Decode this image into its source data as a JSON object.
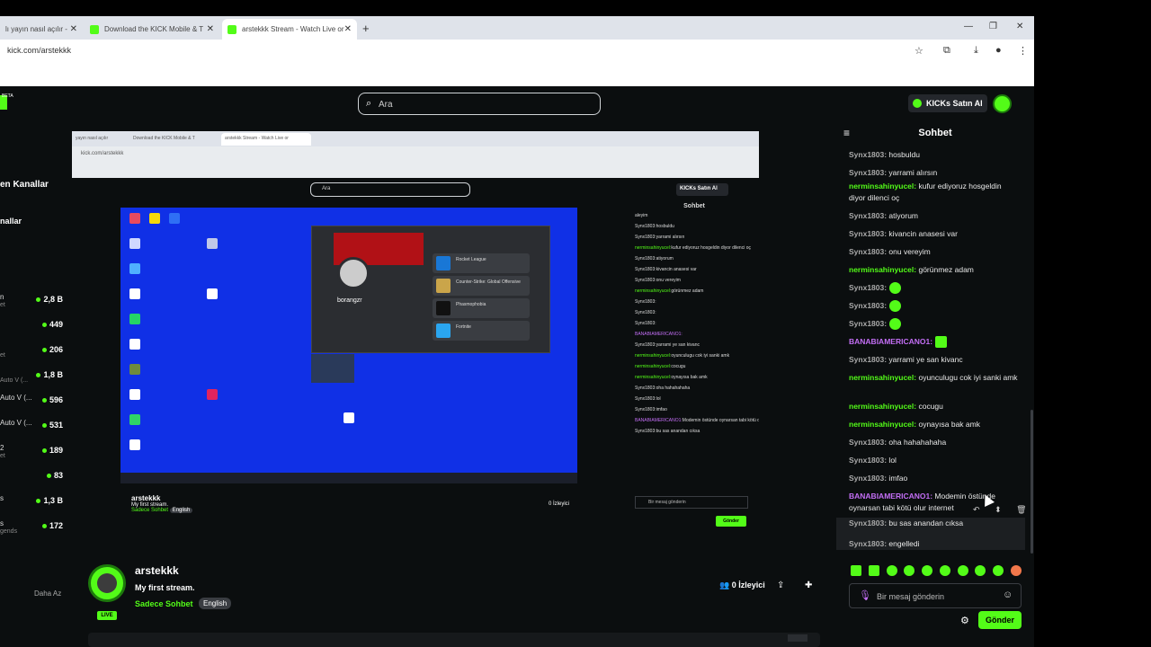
{
  "browser": {
    "tabs": [
      {
        "label": "lı yayın nasıl açılır - "
      },
      {
        "label": "Download the KICK Mobile & T"
      },
      {
        "label": "arstekkk Stream - Watch Live or"
      }
    ],
    "address": "kick.com/arstekkk"
  },
  "topnav": {
    "search_placeholder": "Ara",
    "kicks_label": "KICKs Satın Al",
    "beta": "BETA"
  },
  "sidebar": {
    "title1": "en Kanallar",
    "title2": "nallar",
    "items": [
      {
        "name": "n",
        "sub": "et",
        "count": "2,8 B"
      },
      {
        "name": "",
        "sub": "",
        "count": "449"
      },
      {
        "name": "",
        "sub": "et",
        "count": "206"
      },
      {
        "name": "",
        "sub": "Auto V (...",
        "count": "1,8 B"
      },
      {
        "name": "Auto V (...",
        "sub": "",
        "count": "596"
      },
      {
        "name": "Auto V (...",
        "sub": "",
        "count": "531"
      },
      {
        "name": "2",
        "sub": "et",
        "count": "189"
      },
      {
        "name": "",
        "sub": "",
        "count": "83"
      },
      {
        "name": "s",
        "sub": "",
        "count": "1,3 B"
      },
      {
        "name": "s",
        "sub": "gends",
        "count": "172"
      }
    ],
    "more": "Daha Az"
  },
  "inner": {
    "tabs": [
      "yayın nasıl açılır",
      "Download the KICK Mobile & T",
      "arstekkk Stream - Watch Live or"
    ],
    "address": "kick.com/arstekkk",
    "search": "Ara",
    "kicks": "KICKs Satın Al",
    "dialog_name": "borangzr",
    "games": [
      "Rocket League",
      "Counter-Strike: Global Offensive",
      "Phasmophobia",
      "Fortnite"
    ],
    "chat_title": "Sohbet",
    "chat_lines": [
      [
        "",
        "aleyim"
      ],
      [
        "Synx1803:",
        "hosbuldu"
      ],
      [
        "Synx1803:",
        "yarrami alırsın"
      ],
      [
        "nerminsahinyucel:",
        "kufur ediyoruz hosgeldin diyor dilenci oç"
      ],
      [
        "Synx1803:",
        "atiyorum"
      ],
      [
        "Synx1803:",
        "kivancin anasesi var"
      ],
      [
        "Synx1803:",
        "onu vereyim"
      ],
      [
        "nerminsahinyucel:",
        "görünmez adam"
      ],
      [
        "Synx1803:",
        ""
      ],
      [
        "Synx1803:",
        ""
      ],
      [
        "Synx1803:",
        ""
      ],
      [
        "BANABIAMERICANO1:",
        ""
      ],
      [
        "Synx1803:",
        "yarrami ye san kivanc"
      ],
      [
        "nerminsahinyucel:",
        "oyunculugu cok iyi sanki amk"
      ],
      [
        "nerminsahinyucel:",
        "cocugu"
      ],
      [
        "nerminsahinyucel:",
        "oynayısa bak amk"
      ],
      [
        "Synx1803:",
        "oha hahahahaha"
      ],
      [
        "Synx1803:",
        "lol"
      ],
      [
        "Synx1803:",
        "imfao"
      ],
      [
        "BANABIAMERICANO1:",
        "Modemin östünde oynarsan tabi kötü olur internet"
      ],
      [
        "Synx1803:",
        "bu sas anandan cıksa"
      ]
    ],
    "chat_placeholder": "Bir mesaj gönderin",
    "send": "Gönder",
    "streamer": "arstekkk",
    "title": "My first stream.",
    "category": "Sadece Sohbet",
    "lang": "English",
    "viewers": "0 İzleyici"
  },
  "stream": {
    "name": "arstekkk",
    "title": "My first stream.",
    "category": "Sadece Sohbet",
    "language": "English",
    "viewers": "0 İzleyici",
    "live": "LIVE"
  },
  "chat": {
    "title": "Sohbet",
    "messages": [
      {
        "user": "Synx1803:",
        "text": " hosbuldu",
        "color": "gray"
      },
      {
        "user": "Synx1803:",
        "text": " yarrami alırsın",
        "color": "gray"
      },
      {
        "user": "nerminsahinyucel:",
        "text": " kufur ediyoruz hosgeldin diyor dilenci oç",
        "color": "green"
      },
      {
        "user": "Synx1803:",
        "text": " atiyorum",
        "color": "gray"
      },
      {
        "user": "Synx1803:",
        "text": " kivancin anasesi var",
        "color": "gray"
      },
      {
        "user": "Synx1803:",
        "text": " onu vereyim",
        "color": "gray"
      },
      {
        "user": "nerminsahinyucel:",
        "text": " görünmez adam",
        "color": "green"
      },
      {
        "user": "Synx1803:",
        "text": "",
        "color": "gray",
        "emote": true
      },
      {
        "user": "Synx1803:",
        "text": "",
        "color": "gray",
        "emote": true
      },
      {
        "user": "Synx1803:",
        "text": "",
        "color": "gray",
        "emote": true
      },
      {
        "user": "BANABIAMERICANO1:",
        "text": "",
        "color": "purple",
        "emote": true
      },
      {
        "user": "Synx1803:",
        "text": " yarrami ye san kivanc",
        "color": "gray"
      },
      {
        "user": "nerminsahinyucel:",
        "text": " oyunculugu cok iyi sanki amk",
        "color": "green"
      },
      {
        "user": "nerminsahinyucel:",
        "text": " cocugu",
        "color": "green"
      },
      {
        "user": "nerminsahinyucel:",
        "text": " oynayısa bak amk",
        "color": "green"
      },
      {
        "user": "Synx1803:",
        "text": " oha hahahahaha",
        "color": "gray"
      },
      {
        "user": "Synx1803:",
        "text": " lol",
        "color": "gray"
      },
      {
        "user": "Synx1803:",
        "text": " imfao",
        "color": "gray"
      },
      {
        "user": "BANABIAMERICANO1:",
        "text": " Modemin östünde oynarsan tabi kötü olur internet",
        "color": "purple"
      },
      {
        "user": "Synx1803:",
        "text": " bu sas anandan cıksa",
        "color": "gray"
      },
      {
        "user": "Synx1803:",
        "text": " engelledi",
        "color": "gray"
      }
    ],
    "input_placeholder": "Bir mesaj gönderin",
    "send_label": "Gönder"
  },
  "colors": {
    "accent": "#53fc18",
    "purple": "#c36ef5",
    "bg": "#0b0e0f"
  }
}
